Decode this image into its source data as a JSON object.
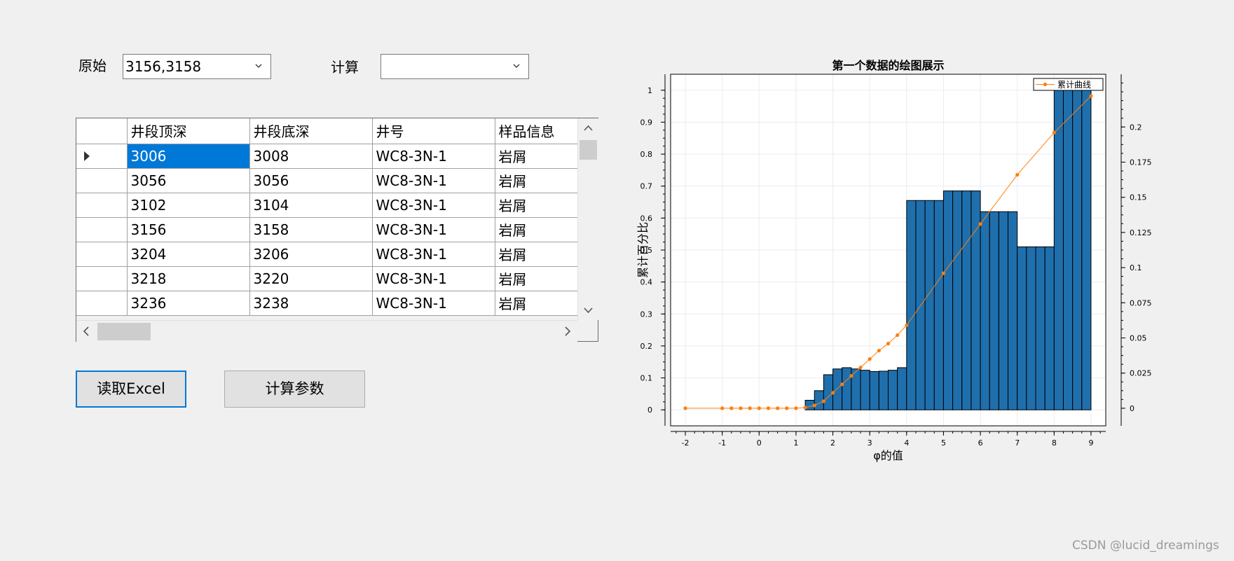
{
  "form": {
    "original_label": "原始",
    "original_value": "3156,3158",
    "calc_label": "计算",
    "calc_value": ""
  },
  "table": {
    "columns": [
      "井段顶深",
      "井段底深",
      "井号",
      "样品信息"
    ],
    "rows": [
      [
        "3006",
        "3008",
        "WC8-3N-1",
        "岩屑"
      ],
      [
        "3056",
        "3056",
        "WC8-3N-1",
        "岩屑"
      ],
      [
        "3102",
        "3104",
        "WC8-3N-1",
        "岩屑"
      ],
      [
        "3156",
        "3158",
        "WC8-3N-1",
        "岩屑"
      ],
      [
        "3204",
        "3206",
        "WC8-3N-1",
        "岩屑"
      ],
      [
        "3218",
        "3220",
        "WC8-3N-1",
        "岩屑"
      ],
      [
        "3236",
        "3238",
        "WC8-3N-1",
        "岩屑"
      ]
    ],
    "current_row": 0
  },
  "buttons": {
    "read_excel": "读取Excel",
    "calc_params": "计算参数"
  },
  "watermark": "CSDN @lucid_dreamings",
  "chart_data": {
    "type": "bar",
    "title": "第一个数据的绘图展示",
    "xlabel": "φ的值",
    "ylabel": "累计百分比",
    "xlim": [
      -2.4,
      9.4
    ],
    "ylim": [
      -0.05,
      1.05
    ],
    "y2lim": [
      -0.0125,
      0.2375
    ],
    "xticks": [
      -2,
      -1,
      0,
      1,
      2,
      3,
      4,
      5,
      6,
      7,
      8,
      9
    ],
    "yticks": [
      0,
      0.1,
      0.2,
      0.3,
      0.4,
      0.5,
      0.6,
      0.7,
      0.8,
      0.9,
      1
    ],
    "y2ticks": [
      0,
      0.025,
      0.05,
      0.075,
      0.1,
      0.125,
      0.15,
      0.175,
      0.2
    ],
    "bar_color": "#1f6fad",
    "line_color": "#ff7f0e",
    "bar_width": 0.25,
    "bars": {
      "x": [
        1.25,
        1.5,
        1.75,
        2.0,
        2.25,
        2.5,
        2.75,
        3.0,
        3.25,
        3.5,
        3.75,
        4.0,
        4.25,
        4.5,
        4.75,
        5.0,
        5.25,
        5.5,
        5.75,
        6.0,
        6.25,
        6.5,
        6.75,
        7.0,
        7.25,
        7.5,
        7.75,
        8.0,
        8.25,
        8.5,
        8.75
      ],
      "values": [
        0.03,
        0.06,
        0.11,
        0.128,
        0.132,
        0.128,
        0.124,
        0.12,
        0.121,
        0.124,
        0.132,
        0.655,
        0.655,
        0.655,
        0.655,
        0.685,
        0.685,
        0.685,
        0.685,
        0.62,
        0.62,
        0.62,
        0.62,
        0.51,
        0.51,
        0.51,
        0.51,
        1.0,
        1.0,
        1.0,
        1.0
      ]
    },
    "series": [
      {
        "name": "累计曲线",
        "axis": "y2",
        "x": [
          -2,
          -1,
          -0.75,
          -0.5,
          -0.25,
          0,
          0.25,
          0.5,
          0.75,
          1.0,
          1.25,
          1.5,
          1.75,
          2.0,
          2.25,
          2.5,
          2.75,
          3.0,
          3.25,
          3.5,
          3.75,
          4.0,
          5.0,
          6.0,
          7.0,
          8.0,
          9.0
        ],
        "values": [
          0,
          0,
          0,
          0,
          0,
          0,
          0,
          0,
          0,
          0,
          0.0005,
          0.002,
          0.005,
          0.011,
          0.017,
          0.023,
          0.029,
          0.035,
          0.041,
          0.046,
          0.052,
          0.059,
          0.096,
          0.131,
          0.166,
          0.196,
          0.222
        ]
      }
    ],
    "legend": "top-right",
    "grid": true
  }
}
